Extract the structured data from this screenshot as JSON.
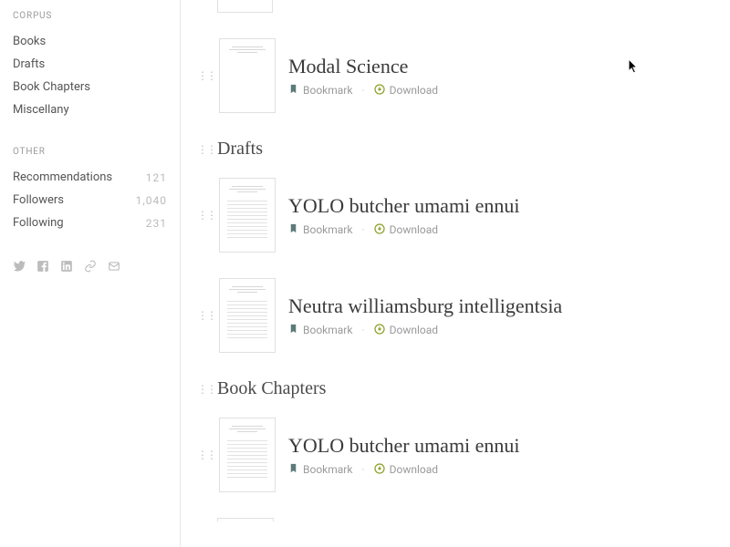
{
  "sidebar": {
    "corpus": {
      "heading": "CORPUS",
      "items": [
        "Books",
        "Drafts",
        "Book Chapters",
        "Miscellany"
      ]
    },
    "other": {
      "heading": "OTHER",
      "items": [
        {
          "label": "Recommendations",
          "count": "121"
        },
        {
          "label": "Followers",
          "count": "1,040"
        },
        {
          "label": "Following",
          "count": "231"
        }
      ]
    }
  },
  "actions": {
    "bookmark": "Bookmark",
    "download": "Download"
  },
  "sections": {
    "drafts": "Drafts",
    "chapters": "Book Chapters"
  },
  "items": {
    "modal": "Modal Science",
    "yolo1": "YOLO butcher umami ennui",
    "neutra": "Neutra williamsburg intelligentsia",
    "yolo2": "YOLO butcher umami ennui"
  }
}
